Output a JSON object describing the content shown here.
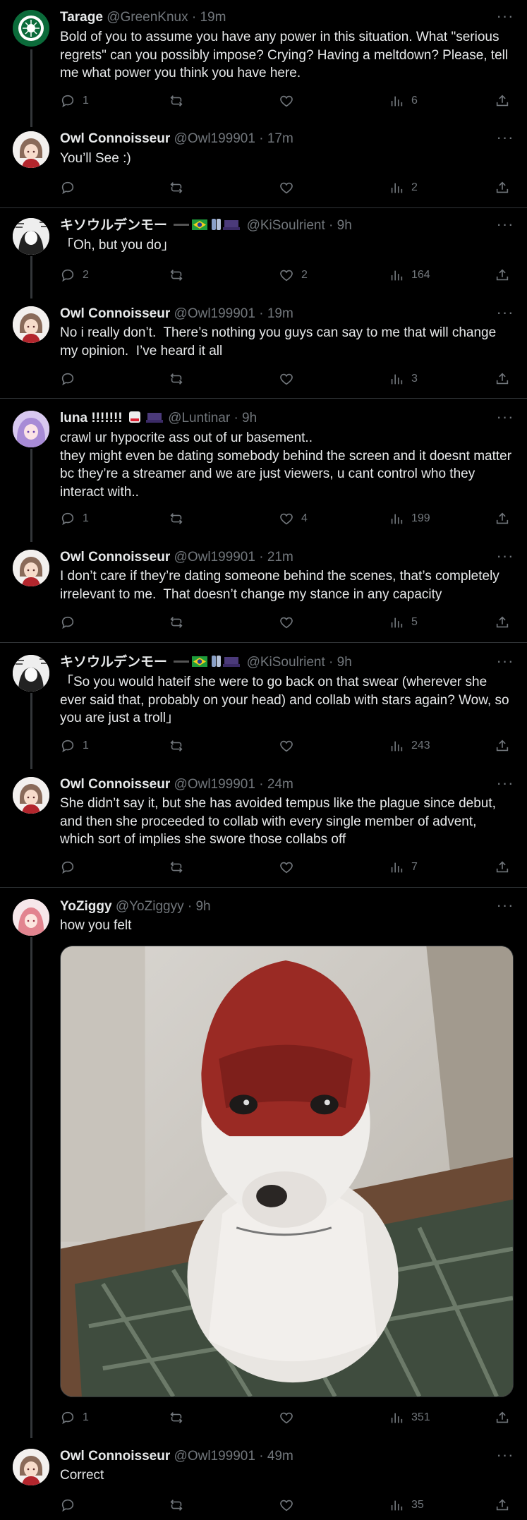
{
  "tweets": [
    {
      "name": "Tarage",
      "handle": "@GreenKnux",
      "time": "· 19m",
      "text": "Bold of you to assume you have any power in this situation. What \"serious regrets\" can you possibly impose? Crying? Having a meltdown? Please, tell me what power you think you have here.",
      "replies": "1",
      "retweets": "",
      "likes": "",
      "views": "6",
      "avatar_badge": "CAFFINATED SPIDER"
    },
    {
      "name": "Owl Connoisseur",
      "handle": "@Owl199901",
      "time": "· 17m",
      "text": "You’ll See :)",
      "replies": "",
      "retweets": "",
      "likes": "",
      "views": "2"
    },
    {
      "name": "キソウルデンモー",
      "handle": "@KiSoulrient",
      "time": "· 9h",
      "text": "「Oh, but you do」",
      "replies": "2",
      "retweets": "",
      "likes": "2",
      "views": "164"
    },
    {
      "name": "Owl Connoisseur",
      "handle": "@Owl199901",
      "time": "· 19m",
      "text": "No i really don’t.  There’s nothing you guys can say to me that will change my opinion.  I’ve heard it all",
      "replies": "",
      "retweets": "",
      "likes": "",
      "views": "3"
    },
    {
      "name": "luna !!!!!!!",
      "handle": "@Luntinar",
      "time": "· 9h",
      "text": "crawl ur hypocrite ass out of ur basement..\nthey might even be dating somebody behind the screen and it doesnt matter bc they’re a streamer and we are just viewers, u cant control who they interact with..",
      "replies": "1",
      "retweets": "",
      "likes": "4",
      "views": "199"
    },
    {
      "name": "Owl Connoisseur",
      "handle": "@Owl199901",
      "time": "· 21m",
      "text": "I don’t care if they’re dating someone behind the scenes, that’s completely irrelevant to me.  That doesn’t change my stance in any capacity",
      "replies": "",
      "retweets": "",
      "likes": "",
      "views": "5"
    },
    {
      "name": "キソウルデンモー",
      "handle": "@KiSoulrient",
      "time": "· 9h",
      "text": "「So you would hateif she were to go back on that swear (wherever she ever said that, probably on your head) and collab with stars again? Wow, so you are just a troll」",
      "replies": "1",
      "retweets": "",
      "likes": "",
      "views": "243"
    },
    {
      "name": "Owl Connoisseur",
      "handle": "@Owl199901",
      "time": "· 24m",
      "text": "She didn’t say it, but she has avoided tempus like the plague since debut, and then she proceeded to collab with every single member of advent, which sort of implies she swore those collabs off",
      "replies": "",
      "retweets": "",
      "likes": "",
      "views": "7"
    },
    {
      "name": "YoZiggy",
      "handle": "@YoZiggyy",
      "time": "· 9h",
      "text": "how you felt",
      "replies": "1",
      "retweets": "",
      "likes": "",
      "views": "351"
    },
    {
      "name": "Owl Connoisseur",
      "handle": "@Owl199901",
      "time": "· 49m",
      "text": "Correct",
      "replies": "",
      "retweets": "",
      "likes": "",
      "views": "35"
    }
  ],
  "more_glyph": "···",
  "icons": {
    "reply": "reply-icon",
    "retweet": "retweet-icon",
    "like": "heart-icon",
    "views": "views-icon",
    "share": "share-icon",
    "more": "more-icon"
  },
  "colors": {
    "background": "#000000",
    "text": "#e7e9ea",
    "muted": "#71767b",
    "divider": "#2f3336"
  }
}
